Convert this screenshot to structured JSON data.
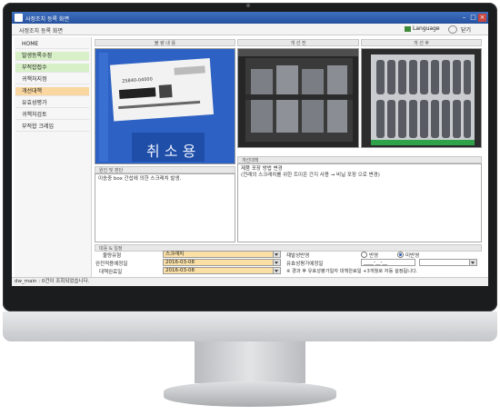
{
  "window": {
    "title": "사정조치 등록 화면",
    "subtitle": "사정조치 등록 화면",
    "language_label": "Language",
    "close_label": "닫기"
  },
  "sidebar": {
    "items": [
      {
        "label": "HOME",
        "color": "#ffffff"
      },
      {
        "label": "발생등록수정",
        "color": "#d7f0c7"
      },
      {
        "label": "부적합접수",
        "color": "#d7f0c7"
      },
      {
        "label": "귀책처지정",
        "color": "#f6f6f6"
      },
      {
        "label": "개선대책",
        "color": "#fad7a0"
      },
      {
        "label": "유효성평가",
        "color": "#f6f6f6"
      },
      {
        "label": "귀책처검토",
        "color": "#f6f6f6"
      },
      {
        "label": "부적합 크레임",
        "color": "#f6f6f6"
      }
    ]
  },
  "photos": {
    "headers": [
      "불 량 내 용",
      "개 선 전",
      "개 선 후"
    ],
    "label_text": "25840-04000"
  },
  "cause": {
    "header": "원인 및 판단",
    "text": "이송중 box 간섭에 의한 스크래치 발생."
  },
  "measure": {
    "header": "개선대책",
    "line1": "제품 포장 방법 변경",
    "line2": "(전례의 스크래치를 위한 트이온 간지 사용 → 비닐 포장 으로 변경)"
  },
  "schedule": {
    "header": "대응 & 일정",
    "defect_type_label": "불량유형",
    "defect_type_value": "스크래치",
    "complete_plan_label": "완전적용예정일",
    "complete_plan_value": "2016-03-08",
    "reply_date_label": "대책완료일",
    "reply_date_value": "2016-03-08",
    "recurrence_label": "재발성반영",
    "radio_yes": "반영",
    "radio_no": "미반영",
    "eval_date_label": "유효성평가예정일",
    "eval_date_value": "____-__-__",
    "eval_result_label": "유효성평가결과",
    "note": "※ 경과 후 유효성평가일자 대책완료일 +3개월로 자동 설정됩니다."
  },
  "status": {
    "text": "dw_main : 0건이 조회되었습니다."
  },
  "colors": {
    "titlebar": "#2f5fb0",
    "highlight_orange": "#fbe0a6",
    "green_item": "#d7f0c7"
  }
}
